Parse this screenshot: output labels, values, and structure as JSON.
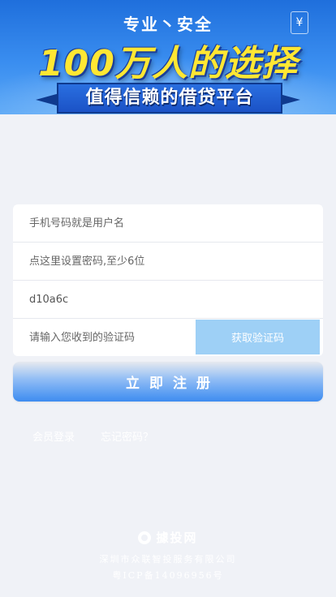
{
  "banner": {
    "tagline": "专业丶安全",
    "yen": "¥",
    "headline": "100万人的选择",
    "subline": "值得信赖的借贷平台"
  },
  "form": {
    "phone_placeholder": "手机号码就是用户名",
    "password_placeholder": "点这里设置密码,至少6位",
    "captcha_value": "d10a6c",
    "code_placeholder": "请输入您收到的验证码",
    "get_code_label": "获取验证码"
  },
  "submit_label": "立即注册",
  "links": {
    "login": "会员登录",
    "forgot": "忘记密码？"
  },
  "footer": {
    "brand": "據投网",
    "company": "深圳市众联智投服务有限公司",
    "icp": "粤ICP备14096956号"
  },
  "colors": {
    "accent": "#3d8cf0",
    "code_button": "#9ed0f6",
    "background": "#f0f2f7"
  }
}
